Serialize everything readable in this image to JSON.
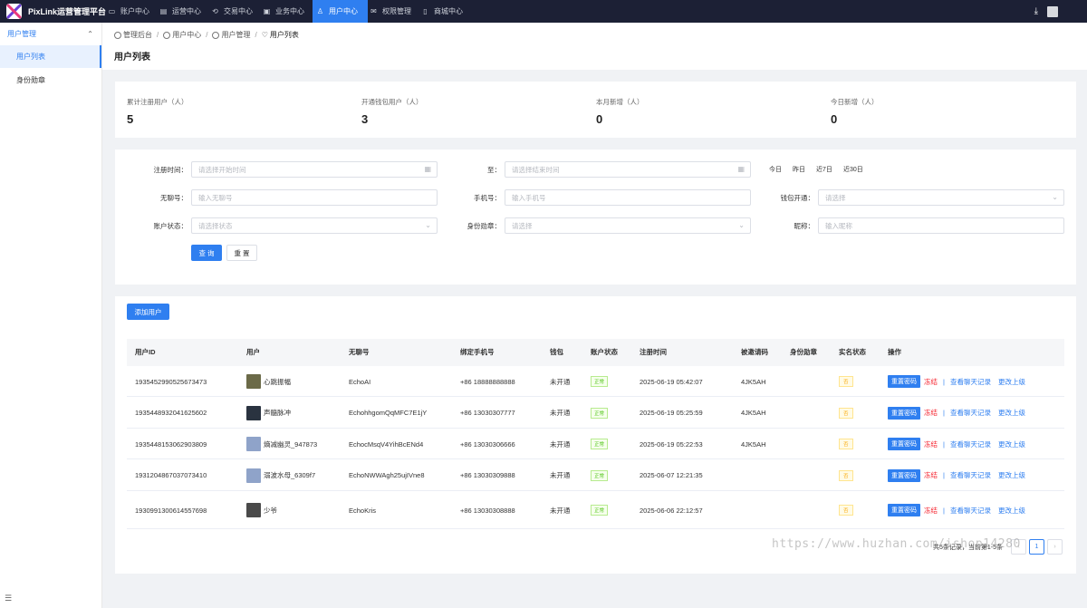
{
  "app": {
    "title": "PixLink运营管理平台"
  },
  "topnav": [
    {
      "label": "账户中心",
      "icon": "wallet-icon",
      "active": false
    },
    {
      "label": "运营中心",
      "icon": "chart-icon",
      "active": false
    },
    {
      "label": "交易中心",
      "icon": "exchange-icon",
      "active": false
    },
    {
      "label": "业务中心",
      "icon": "monitor-icon",
      "active": false
    },
    {
      "label": "用户中心",
      "icon": "user-icon",
      "active": true
    },
    {
      "label": "权限管理",
      "icon": "mail-icon",
      "active": false
    },
    {
      "label": "商城中心",
      "icon": "doc-icon",
      "active": false
    }
  ],
  "sidebar": {
    "group": "用户管理",
    "items": [
      {
        "label": "用户列表",
        "active": true
      },
      {
        "label": "身份勋章",
        "active": false
      }
    ]
  },
  "breadcrumb": [
    "管理后台",
    "用户中心",
    "用户管理",
    "用户列表"
  ],
  "page_title": "用户列表",
  "stats": [
    {
      "label": "累计注册用户（人）",
      "value": "5"
    },
    {
      "label": "开通钱包用户（人）",
      "value": "3"
    },
    {
      "label": "本月新增（人）",
      "value": "0"
    },
    {
      "label": "今日新增（人）",
      "value": "0"
    }
  ],
  "filters": {
    "reg_time_label": "注册时间：",
    "reg_start_placeholder": "请选择开始时间",
    "to_label": "至：",
    "reg_end_placeholder": "请选择结束时间",
    "quick": [
      "今日",
      "昨日",
      "近7日",
      "近30日"
    ],
    "wuliao_label": "无聊号：",
    "wuliao_placeholder": "输入无聊号",
    "phone_label": "手机号：",
    "phone_placeholder": "输入手机号",
    "wallet_label": "钱包开通：",
    "wallet_placeholder": "请选择",
    "status_label": "账户状态：",
    "status_placeholder": "请选择状态",
    "badge_label": "身份勋章：",
    "badge_placeholder": "请选择",
    "nick_label": "昵称：",
    "nick_placeholder": "输入昵称",
    "search_button": "查 询",
    "reset_button": "重 置"
  },
  "add_user_button": "添加用户",
  "table": {
    "headers": [
      "用户ID",
      "用户",
      "无聊号",
      "绑定手机号",
      "钱包",
      "账户状态",
      "注册时间",
      "被邀请码",
      "身份勋章",
      "实名状态",
      "操作"
    ],
    "rows": [
      {
        "id": "1935452990525673473",
        "user": "心跳振幅",
        "avatar_color": "#6b6a48",
        "wuliao": "EchoAI",
        "phone": "+86 18888888888",
        "wallet": "未开通",
        "status": "正常",
        "reg_time": "2025-06-19 05:42:07",
        "invite": "4JK5AH",
        "badge": "",
        "realname": "否"
      },
      {
        "id": "1935448932041625602",
        "user": "声髓脉冲",
        "avatar_color": "#2a3340",
        "wuliao": "EchohhgomQqMFC7E1jY",
        "phone": "+86 13030307777",
        "wallet": "未开通",
        "status": "正常",
        "reg_time": "2025-06-19 05:25:59",
        "invite": "4JK5AH",
        "badge": "",
        "realname": "否"
      },
      {
        "id": "1935448153062903809",
        "user": "熵减幽灵_947873",
        "avatar_color": "#8fa3c9",
        "wuliao": "EchocMsqV4YihBcENd4",
        "phone": "+86 13030306666",
        "wallet": "未开通",
        "status": "正常",
        "reg_time": "2025-06-19 05:22:53",
        "invite": "4JK5AH",
        "badge": "",
        "realname": "否"
      },
      {
        "id": "1931204867037073410",
        "user": "溺波水母_6309f7",
        "avatar_color": "#8fa3c9",
        "wuliao": "EchoNWWAgh25ujIVne8",
        "phone": "+86 13030309888",
        "wallet": "未开通",
        "status": "正常",
        "reg_time": "2025-06-07 12:21:35",
        "invite": "",
        "badge": "",
        "realname": "否"
      },
      {
        "id": "1930991300614557698",
        "user": "少爷",
        "avatar_color": "#4a4a4a",
        "wuliao": "EchoKris",
        "phone": "+86 13030308888",
        "wallet": "未开通",
        "status": "正常",
        "reg_time": "2025-06-06 22:12:57",
        "invite": "",
        "badge": "",
        "realname": "否"
      }
    ],
    "actions": {
      "reset_pwd": "重置密码",
      "freeze": "冻结",
      "sep": "|",
      "chat": "查看聊天记录",
      "superior": "更改上级"
    }
  },
  "pagination": {
    "total": "共5条记录，当前第1-5条",
    "current": "1"
  },
  "watermark": "https://www.huzhan.com/ishop14280"
}
